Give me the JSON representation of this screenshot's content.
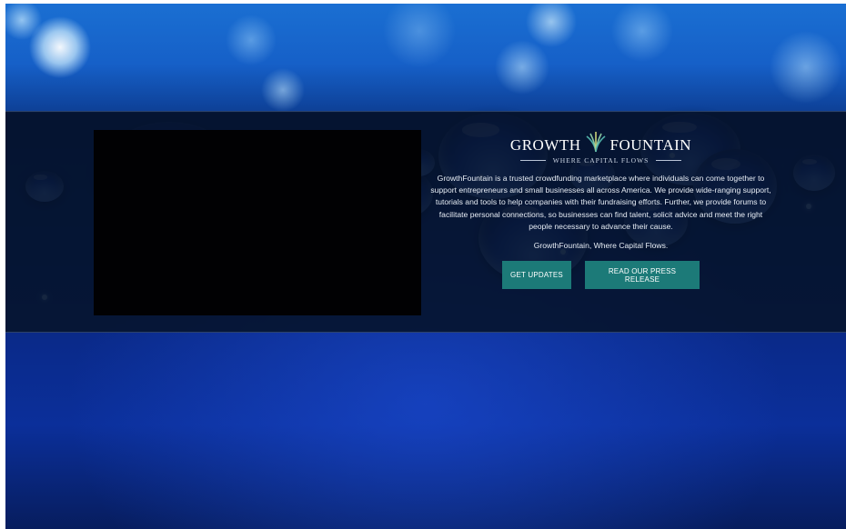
{
  "brand": {
    "word_left": "GROWTH",
    "word_right": "FOUNTAIN",
    "tagline": "WHERE CAPITAL FLOWS",
    "accent_color": "#1c7a78"
  },
  "about": {
    "description": "GrowthFountain is a trusted crowdfunding marketplace where individuals can come together to support entrepreneurs and small businesses all across America. We provide wide-ranging support, tutorials and tools to help companies with their fundraising efforts. Further, we provide forums to facilitate personal connections, so businesses can find talent, solicit advice and meet the right people necessary to advance their cause.",
    "motto": "GrowthFountain, Where Capital Flows."
  },
  "actions": {
    "get_updates_label": "GET UPDATES",
    "press_release_label": "READ OUR PRESS RELEASE"
  },
  "media": {
    "video_icon": "video-player"
  }
}
